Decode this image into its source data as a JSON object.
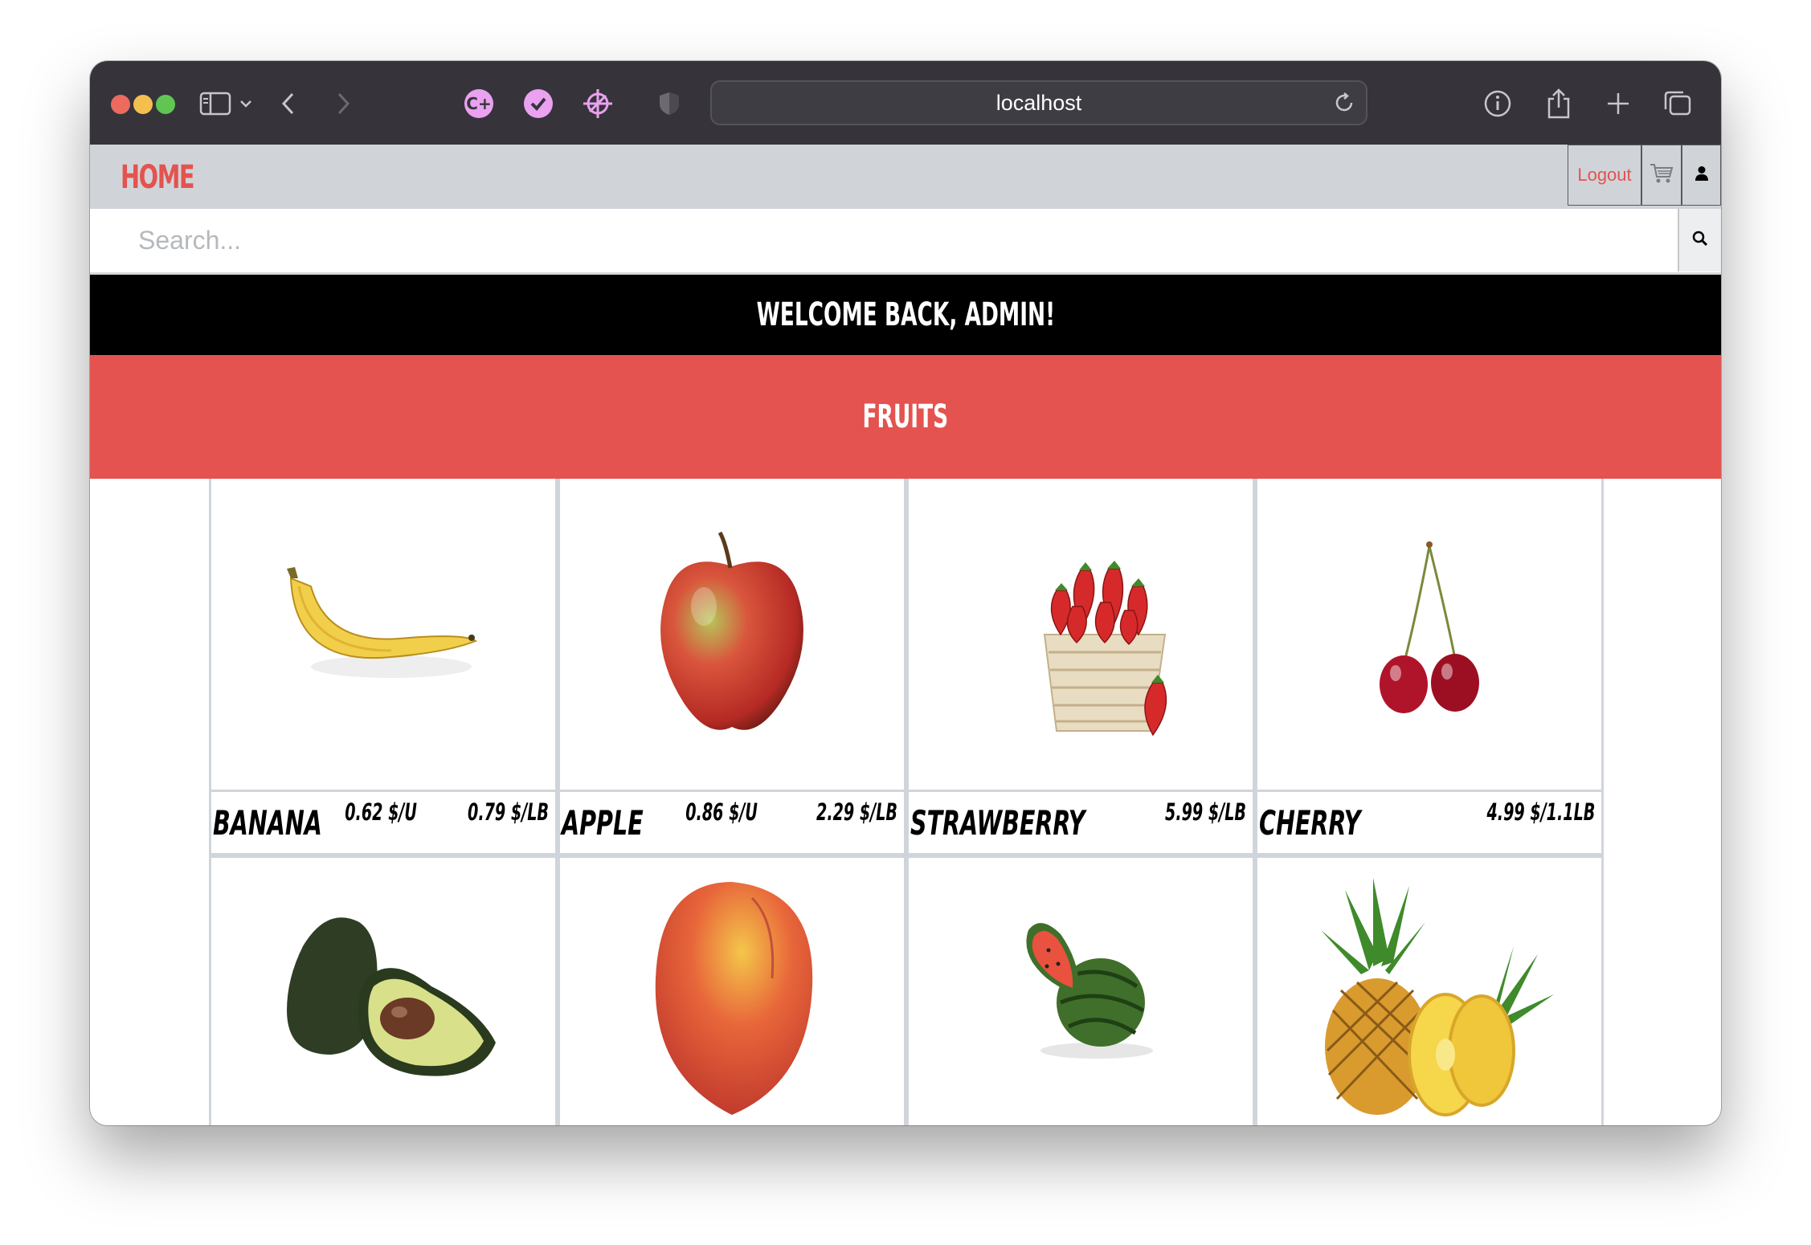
{
  "browser": {
    "url": "localhost"
  },
  "nav": {
    "home": "HOME",
    "logout": "Logout"
  },
  "search": {
    "placeholder": "Search..."
  },
  "welcome": "WELCOME BACK, ADMIN!",
  "section_title": "FRUITS",
  "products": [
    {
      "name": "BANANA",
      "price_unit": "0.62 $/U",
      "price_weight": "0.79 $/LB",
      "image": "banana"
    },
    {
      "name": "APPLE",
      "price_unit": "0.86 $/U",
      "price_weight": "2.29 $/LB",
      "image": "apple"
    },
    {
      "name": "STRAWBERRY",
      "price_weight": "5.99 $/LB",
      "image": "strawberries"
    },
    {
      "name": "CHERRY",
      "price_weight": "4.99 $/1.1LB",
      "image": "cherries"
    },
    {
      "image": "avocado"
    },
    {
      "image": "peach"
    },
    {
      "image": "watermelon"
    },
    {
      "image": "pineapple"
    }
  ],
  "colors": {
    "accent": "#e4534f",
    "nav_bg": "#d0d4d9",
    "toolbar_bg": "#36343a"
  }
}
